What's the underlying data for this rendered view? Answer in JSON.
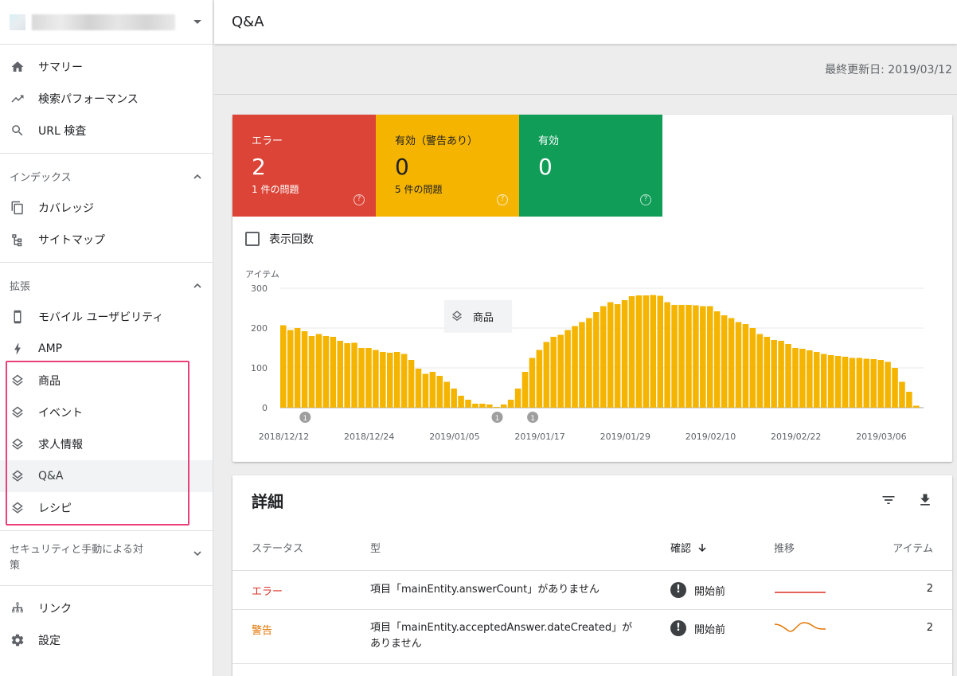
{
  "sidebar": {
    "top_items": [
      {
        "label": "サマリー",
        "icon": "home-icon"
      },
      {
        "label": "検索パフォーマンス",
        "icon": "trending-icon"
      },
      {
        "label": "URL 検査",
        "icon": "search-icon"
      }
    ],
    "index_section": {
      "title": "インデックス",
      "items": [
        {
          "label": "カバレッジ",
          "icon": "copy-icon"
        },
        {
          "label": "サイトマップ",
          "icon": "sitemap-icon"
        }
      ]
    },
    "enhance_section": {
      "title": "拡張",
      "items": [
        {
          "label": "モバイル ユーザビリティ",
          "icon": "phone-icon"
        },
        {
          "label": "AMP",
          "icon": "bolt-icon"
        },
        {
          "label": "商品",
          "icon": "layers-icon"
        },
        {
          "label": "イベント",
          "icon": "layers-icon"
        },
        {
          "label": "求人情報",
          "icon": "layers-icon"
        },
        {
          "label": "Q&A",
          "icon": "layers-icon",
          "active": true
        },
        {
          "label": "レシピ",
          "icon": "layers-icon"
        }
      ]
    },
    "security_section": {
      "title": "セキュリティと手動による対策"
    },
    "bottom_items": [
      {
        "label": "リンク",
        "icon": "links-icon"
      },
      {
        "label": "設定",
        "icon": "gear-icon"
      }
    ]
  },
  "header": {
    "title": "Q&A",
    "updated": "最終更新日: 2019/03/12"
  },
  "tiles": [
    {
      "label": "エラー",
      "value": "2",
      "sub": "1 件の問題",
      "color": "#db4437"
    },
    {
      "label": "有効（警告あり）",
      "value": "0",
      "sub": "5 件の問題",
      "color": "#f4b400"
    },
    {
      "label": "有効",
      "value": "0",
      "sub": "",
      "color": "#0f9d58"
    }
  ],
  "impressions_checkbox": "表示回数",
  "tooltip": "商品",
  "chart_data": {
    "type": "bar",
    "ylabel": "アイテム",
    "ylim": [
      0,
      300
    ],
    "yticks": [
      "0",
      "100",
      "200",
      "300"
    ],
    "x_tick_labels": [
      "2018/12/12",
      "2018/12/24",
      "2019/01/05",
      "2019/01/17",
      "2019/01/29",
      "2019/02/10",
      "2019/02/22",
      "2019/03/06"
    ],
    "annotations": [
      {
        "label": "1",
        "index": 3
      },
      {
        "label": "1",
        "index": 30
      },
      {
        "label": "1",
        "index": 35
      }
    ],
    "bar_color": "#f4b400",
    "series": [
      {
        "values": [
          207,
          195,
          200,
          192,
          180,
          185,
          180,
          178,
          168,
          162,
          163,
          150,
          150,
          145,
          140,
          138,
          140,
          135,
          120,
          98,
          85,
          90,
          80,
          65,
          48,
          30,
          20,
          10,
          10,
          8,
          2,
          8,
          20,
          48,
          90,
          125,
          145,
          165,
          178,
          183,
          195,
          205,
          215,
          225,
          240,
          255,
          265,
          260,
          270,
          280,
          282,
          282,
          283,
          281,
          265,
          258,
          258,
          258,
          257,
          255,
          255,
          242,
          232,
          225,
          215,
          210,
          200,
          185,
          178,
          170,
          168,
          160,
          150,
          148,
          144,
          140,
          135,
          132,
          130,
          128,
          125,
          125,
          123,
          122,
          120,
          115,
          100,
          65,
          40,
          5
        ]
      }
    ]
  },
  "details": {
    "title": "詳細",
    "columns": {
      "status": "ステータス",
      "type": "型",
      "confirm": "確認",
      "trend": "推移",
      "items": "アイテム"
    },
    "rows": [
      {
        "status": "エラー",
        "type": "項目「mainEntity.answerCount」がありません",
        "confirm": "開始前",
        "items": "2"
      },
      {
        "status": "警告",
        "type": "項目「mainEntity.acceptedAnswer.dateCreated」がありません",
        "confirm": "開始前",
        "items": "2"
      }
    ],
    "colors": {
      "error": "#d93025",
      "warning": "#e37400"
    }
  }
}
